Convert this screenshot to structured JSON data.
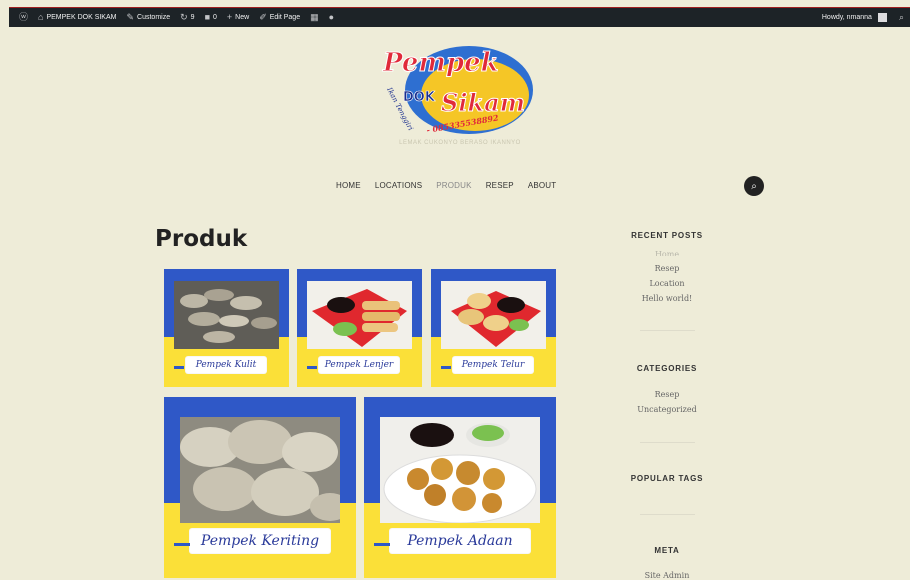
{
  "adminbar": {
    "site_name": "PEMPEK DOK SIKAM",
    "customize": "Customize",
    "updates_count": "9",
    "comments_count": "0",
    "new": "New",
    "edit_page": "Edit Page",
    "howdy": "Howdy, nmanna"
  },
  "site": {
    "logo_word1": "Pempek",
    "logo_word2": "DOK",
    "logo_word3": "Sikam",
    "logo_sub": "Ikan Tenggiri",
    "logo_phone": "- 085335538892",
    "tagline": "LEMAK CUKONYO BERASO IKANNYO"
  },
  "nav": {
    "items": [
      "HOME",
      "LOCATIONS",
      "PRODUK",
      "RESEP",
      "ABOUT"
    ],
    "active_index": 2
  },
  "page": {
    "title": "Produk"
  },
  "products": [
    {
      "label": "Pempek Kulit"
    },
    {
      "label": "Pempek Lenjer"
    },
    {
      "label": "Pempek Telur"
    },
    {
      "label": "Pempek Keriting"
    },
    {
      "label": "Pempek Adaan"
    }
  ],
  "sidebar": {
    "recent_posts_title": "RECENT POSTS",
    "recent_posts": [
      "Home",
      "Resep",
      "Location",
      "Hello world!"
    ],
    "categories_title": "CATEGORIES",
    "categories": [
      "Resep",
      "Uncategorized"
    ],
    "popular_tags_title": "POPULAR TAGS",
    "meta_title": "META",
    "meta_links": [
      "Site Admin"
    ]
  },
  "colors": {
    "page_bg": "#eeecd8",
    "card_blue": "#2f58c7",
    "card_yellow": "#fbe038",
    "label_text": "#2a3a9a"
  }
}
